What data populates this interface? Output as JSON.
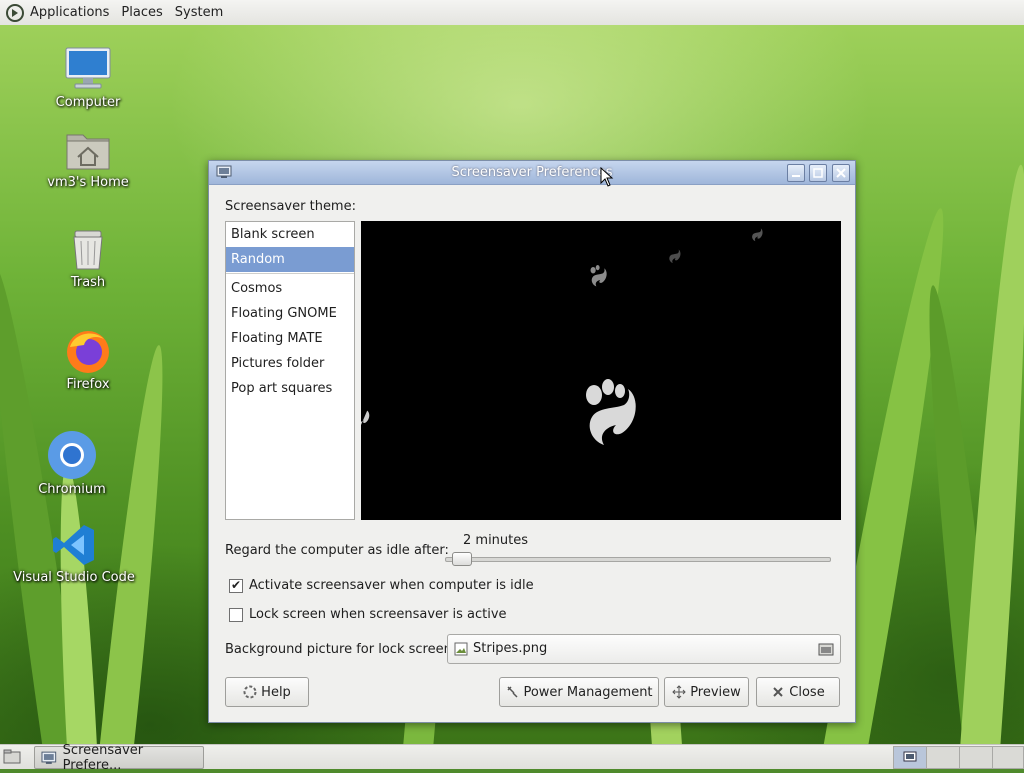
{
  "top_panel": {
    "menus": [
      "Applications",
      "Places",
      "System"
    ]
  },
  "desktop": {
    "icons": [
      {
        "label": "Computer"
      },
      {
        "label": "vm3's Home"
      },
      {
        "label": "Trash"
      },
      {
        "label": "Firefox"
      },
      {
        "label": "Chromium"
      },
      {
        "label": "Visual Studio Code"
      }
    ]
  },
  "window": {
    "title": "Screensaver Preferences",
    "theme_label": "Screensaver theme:",
    "themes": [
      "Blank screen",
      "Random",
      "Cosmos",
      "Floating GNOME",
      "Floating MATE",
      "Pictures folder",
      "Pop art squares"
    ],
    "selected_theme": "Random",
    "idle_label": "Regard the computer as idle after:",
    "idle_value": "2 minutes",
    "idle_slider_fraction": 0.02,
    "activate_label": "Activate screensaver when computer is idle",
    "activate_checked": true,
    "lock_label": "Lock screen when screensaver is active",
    "lock_checked": false,
    "background_label": "Background picture for lock screen:",
    "background_file": "Stripes.png",
    "buttons": {
      "help": "Help",
      "power": "Power Management",
      "preview": "Preview",
      "close": "Close"
    }
  },
  "bottom_panel": {
    "task_label": "Screensaver Prefere..."
  },
  "colors": {
    "selection": "#7a9cd2",
    "titlebar": "#9fb6da"
  }
}
